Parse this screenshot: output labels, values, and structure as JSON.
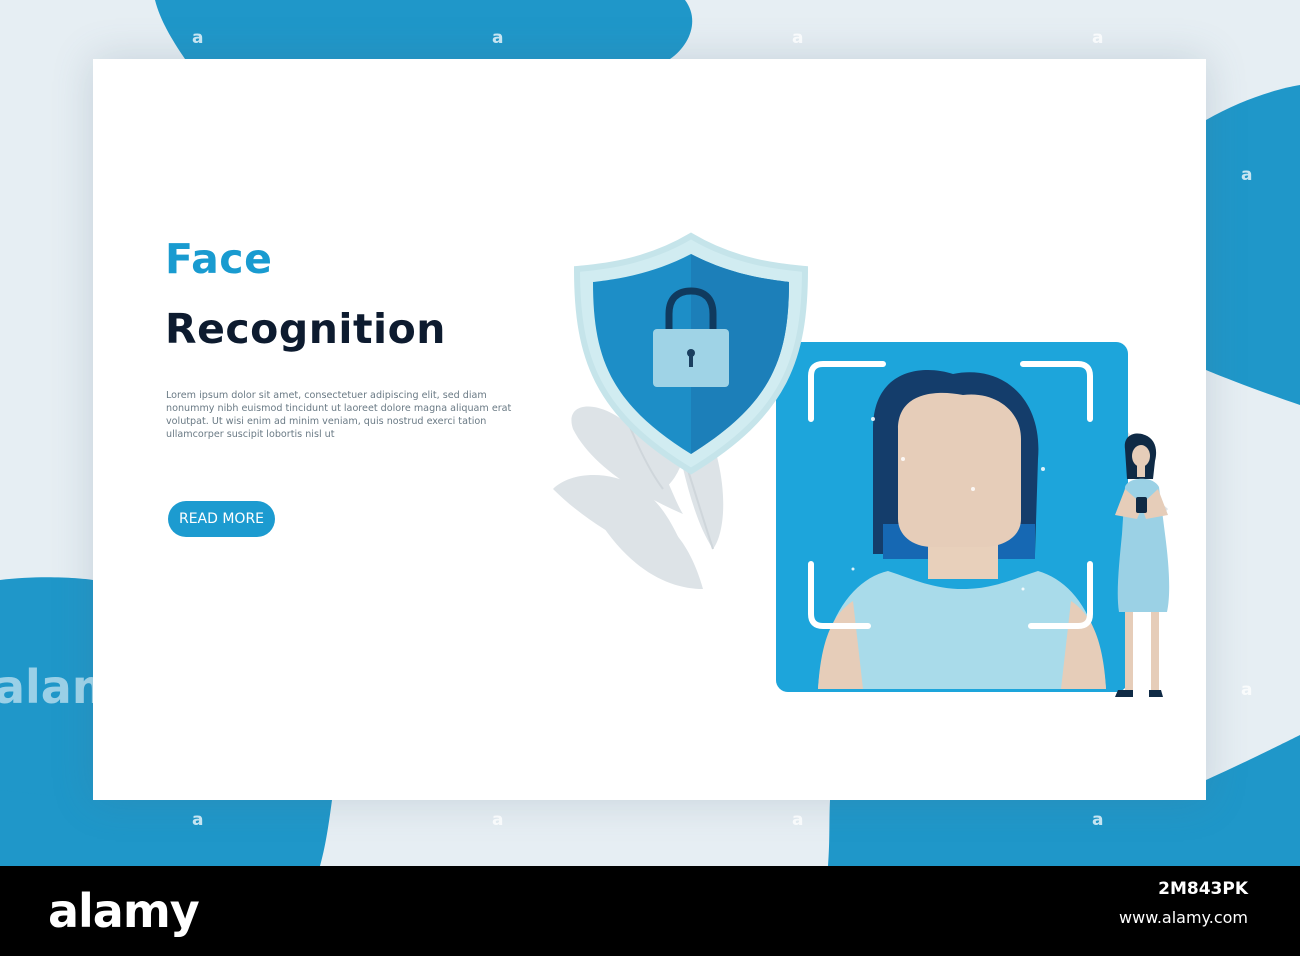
{
  "hero": {
    "title_line1": "Face",
    "title_line2": "Recognition",
    "body": "Lorem ipsum dolor sit amet, consectetuer adipiscing elit, sed diam nonummy nibh euismod tincidunt ut laoreet dolore magna aliquam erat volutpat. Ut wisi enim ad minim veniam, quis nostrud exerci tation ullamcorper suscipit lobortis nisl ut",
    "button_label": "READ MORE"
  },
  "watermark": {
    "text": "alamy",
    "mark": "a"
  },
  "footer": {
    "logo": "alamy",
    "image_code": "2M843PK",
    "url": "www.alamy.com"
  },
  "colors": {
    "accent": "#1c9bd0",
    "dark_text": "#0d1b2f",
    "background": "#e6eef3",
    "footer": "#000000"
  }
}
